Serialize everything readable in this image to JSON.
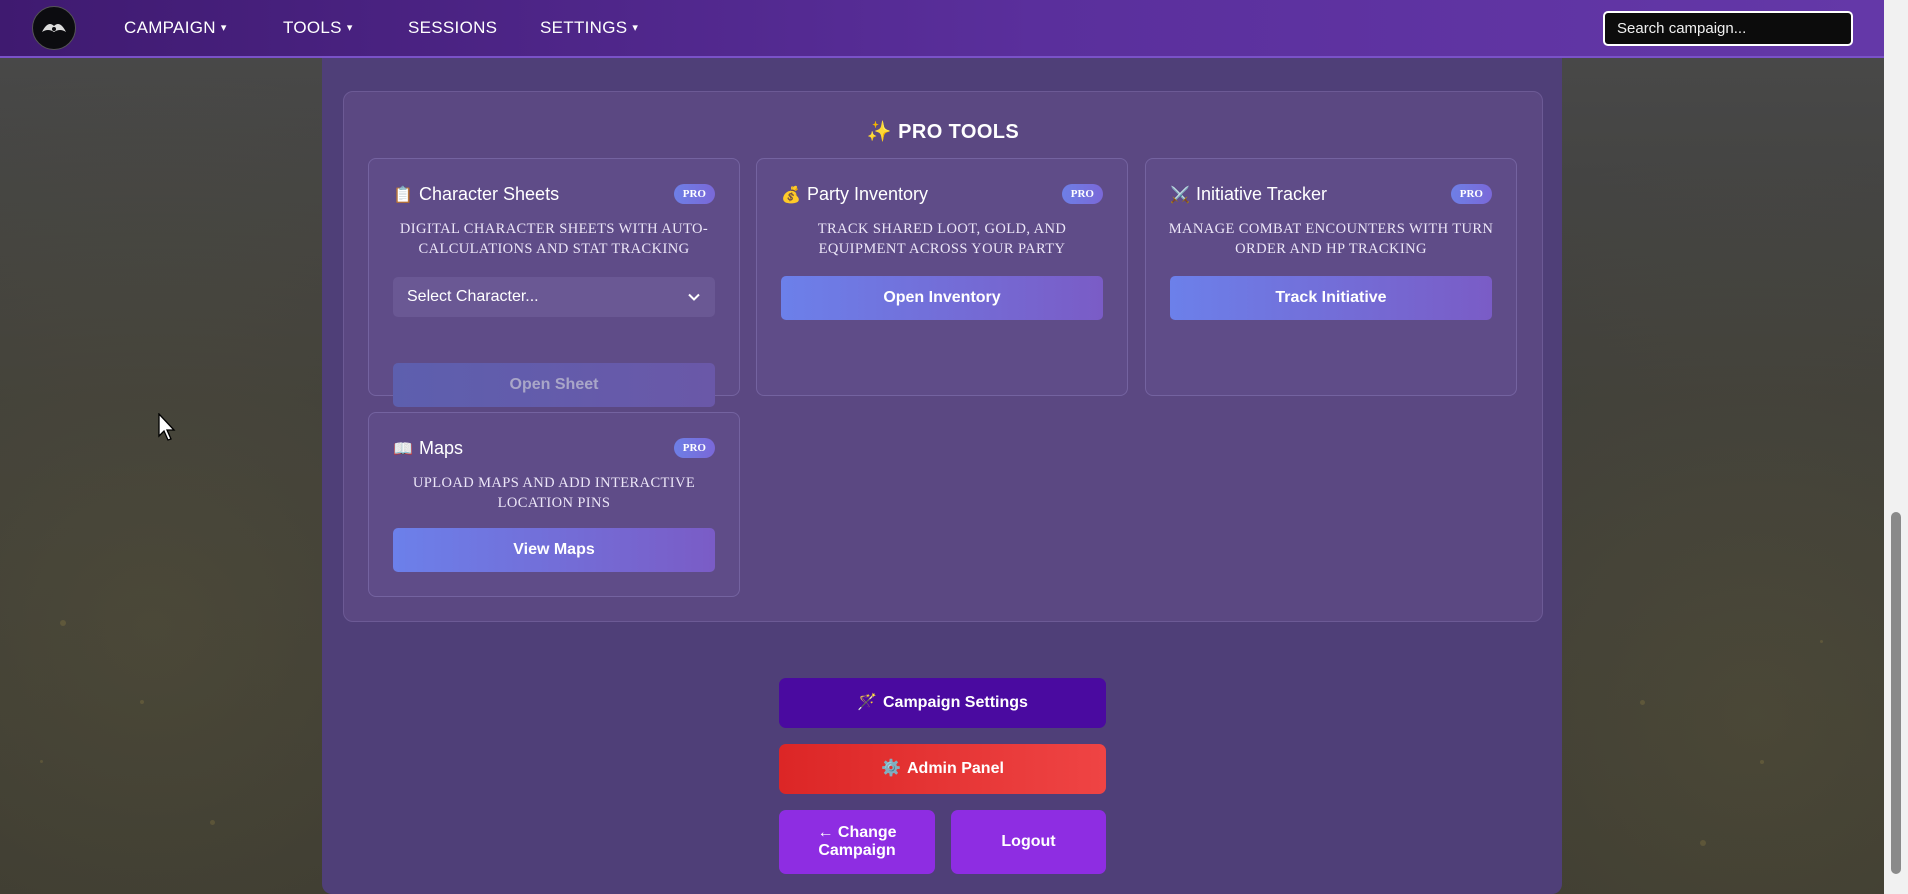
{
  "nav": {
    "items": [
      {
        "label": "CAMPAIGN",
        "caret": "▾"
      },
      {
        "label": "TOOLS",
        "caret": "▾"
      },
      {
        "label": "SESSIONS",
        "caret": ""
      },
      {
        "label": "SETTINGS",
        "caret": "▾"
      }
    ],
    "search_placeholder": "Search campaign..."
  },
  "pro_tools": {
    "title": "PRO TOOLS",
    "title_icon": "sparkles-icon",
    "badge": "PRO",
    "cards": [
      {
        "title": "Character Sheets",
        "icon": "clipboard-icon",
        "description": "Digital character sheets with auto-calculations and stat tracking",
        "select_value": "Select Character...",
        "button": "Open Sheet"
      },
      {
        "title": "Party Inventory",
        "icon": "money-bag-icon",
        "description": "Track shared loot, gold, and equipment across your party",
        "button": "Open Inventory"
      },
      {
        "title": "Initiative Tracker",
        "icon": "crossed-swords-icon",
        "description": "Manage combat encounters with turn order and HP tracking",
        "button": "Track Initiative"
      },
      {
        "title": "Maps",
        "icon": "map-book-icon",
        "description": "Upload maps and add interactive location pins",
        "button": "View Maps"
      }
    ]
  },
  "actions": {
    "campaign_settings": "Campaign Settings",
    "admin_panel": "Admin Panel",
    "change_campaign": "← Change Campaign",
    "logout": "Logout"
  },
  "colors": {
    "nav_start": "#3f1a70",
    "nav_end": "#6438a8",
    "panel": "#4f3f78",
    "campaign_settings_btn": "#4a0aa0",
    "admin_btn": "#e23a3a",
    "change_btn": "#8e2de2",
    "logout_btn": "#8e2de2"
  }
}
